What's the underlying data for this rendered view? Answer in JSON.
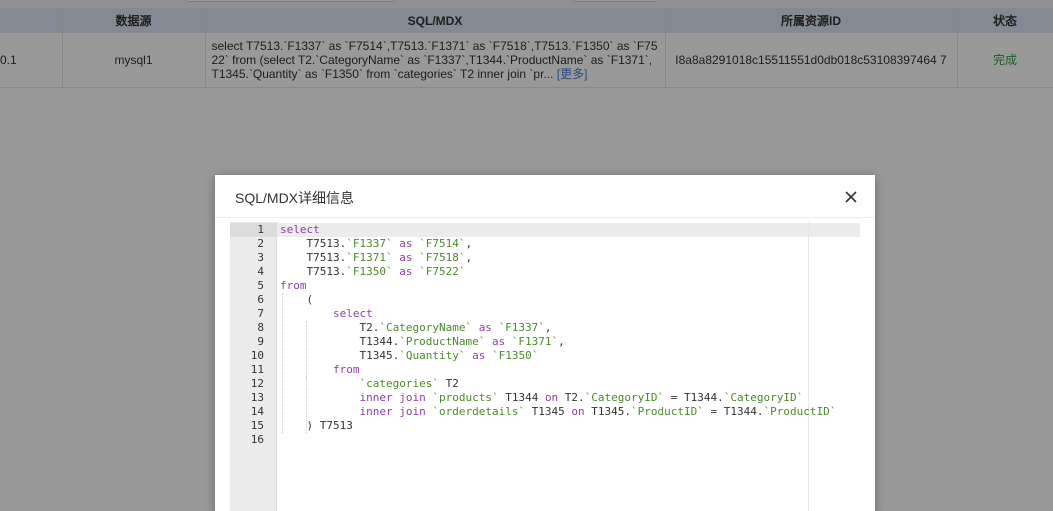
{
  "table": {
    "headers": [
      "",
      "数据源",
      "SQL/MDX",
      "所属资源ID",
      "状态"
    ],
    "row": {
      "ip_partial": "0.1",
      "datasource": "mysql1",
      "sql_preview": "select T7513.`F1337` as `F7514`,T7513.`F1371` as `F7518`,T7513.`F1350` as `F7522` from (select T2.`CategoryName` as `F1337`,T1344.`ProductName` as `F1371`,T1345.`Quantity` as `F1350` from `categories` T2 inner join `pr...",
      "more_label": "[更多]",
      "resource_id": "I8a8a8291018c15511551d0db018c53108397464 7",
      "status": "完成"
    }
  },
  "modal": {
    "title": "SQL/MDX详细信息",
    "close_icon": "close-icon"
  },
  "editor": {
    "line_numbers": [
      "1",
      "2",
      "3",
      "4",
      "5",
      "6",
      "7",
      "8",
      "9",
      "10",
      "11",
      "12",
      "13",
      "14",
      "15",
      "16"
    ],
    "lines": [
      [
        {
          "t": "select",
          "c": "kw"
        }
      ],
      [
        {
          "t": "    T7513."
        },
        {
          "t": "`F1337`",
          "c": "str"
        },
        {
          "t": " "
        },
        {
          "t": "as",
          "c": "kw"
        },
        {
          "t": " "
        },
        {
          "t": "`F7514`",
          "c": "str"
        },
        {
          "t": ","
        }
      ],
      [
        {
          "t": "    T7513."
        },
        {
          "t": "`F1371`",
          "c": "str"
        },
        {
          "t": " "
        },
        {
          "t": "as",
          "c": "kw"
        },
        {
          "t": " "
        },
        {
          "t": "`F7518`",
          "c": "str"
        },
        {
          "t": ","
        }
      ],
      [
        {
          "t": "    T7513."
        },
        {
          "t": "`F1350`",
          "c": "str"
        },
        {
          "t": " "
        },
        {
          "t": "as",
          "c": "kw"
        },
        {
          "t": " "
        },
        {
          "t": "`F7522`",
          "c": "str"
        }
      ],
      [
        {
          "t": "from",
          "c": "kw"
        }
      ],
      [
        {
          "t": "    ("
        }
      ],
      [
        {
          "t": "        "
        },
        {
          "t": "select",
          "c": "kw"
        }
      ],
      [
        {
          "t": "            T2."
        },
        {
          "t": "`CategoryName`",
          "c": "str"
        },
        {
          "t": " "
        },
        {
          "t": "as",
          "c": "kw"
        },
        {
          "t": " "
        },
        {
          "t": "`F1337`",
          "c": "str"
        },
        {
          "t": ","
        }
      ],
      [
        {
          "t": "            T1344."
        },
        {
          "t": "`ProductName`",
          "c": "str"
        },
        {
          "t": " "
        },
        {
          "t": "as",
          "c": "kw"
        },
        {
          "t": " "
        },
        {
          "t": "`F1371`",
          "c": "str"
        },
        {
          "t": ","
        }
      ],
      [
        {
          "t": "            T1345."
        },
        {
          "t": "`Quantity`",
          "c": "str"
        },
        {
          "t": " "
        },
        {
          "t": "as",
          "c": "kw"
        },
        {
          "t": " "
        },
        {
          "t": "`F1350`",
          "c": "str"
        }
      ],
      [
        {
          "t": "        "
        },
        {
          "t": "from",
          "c": "kw"
        }
      ],
      [
        {
          "t": "            "
        },
        {
          "t": "`categories`",
          "c": "str"
        },
        {
          "t": " T2"
        }
      ],
      [
        {
          "t": "            "
        },
        {
          "t": "inner join",
          "c": "kw"
        },
        {
          "t": " "
        },
        {
          "t": "`products`",
          "c": "str"
        },
        {
          "t": " T1344 "
        },
        {
          "t": "on",
          "c": "kw"
        },
        {
          "t": " T2."
        },
        {
          "t": "`CategoryID`",
          "c": "str"
        },
        {
          "t": " = T1344."
        },
        {
          "t": "`CategoryID`",
          "c": "str"
        }
      ],
      [
        {
          "t": "            "
        },
        {
          "t": "inner join",
          "c": "kw"
        },
        {
          "t": " "
        },
        {
          "t": "`orderdetails`",
          "c": "str"
        },
        {
          "t": " T1345 "
        },
        {
          "t": "on",
          "c": "kw"
        },
        {
          "t": " T1345."
        },
        {
          "t": "`ProductID`",
          "c": "str"
        },
        {
          "t": " = T1344."
        },
        {
          "t": "`ProductID`",
          "c": "str"
        }
      ],
      [
        {
          "t": "    ) T7513"
        }
      ],
      [
        {
          "t": ""
        }
      ]
    ]
  }
}
